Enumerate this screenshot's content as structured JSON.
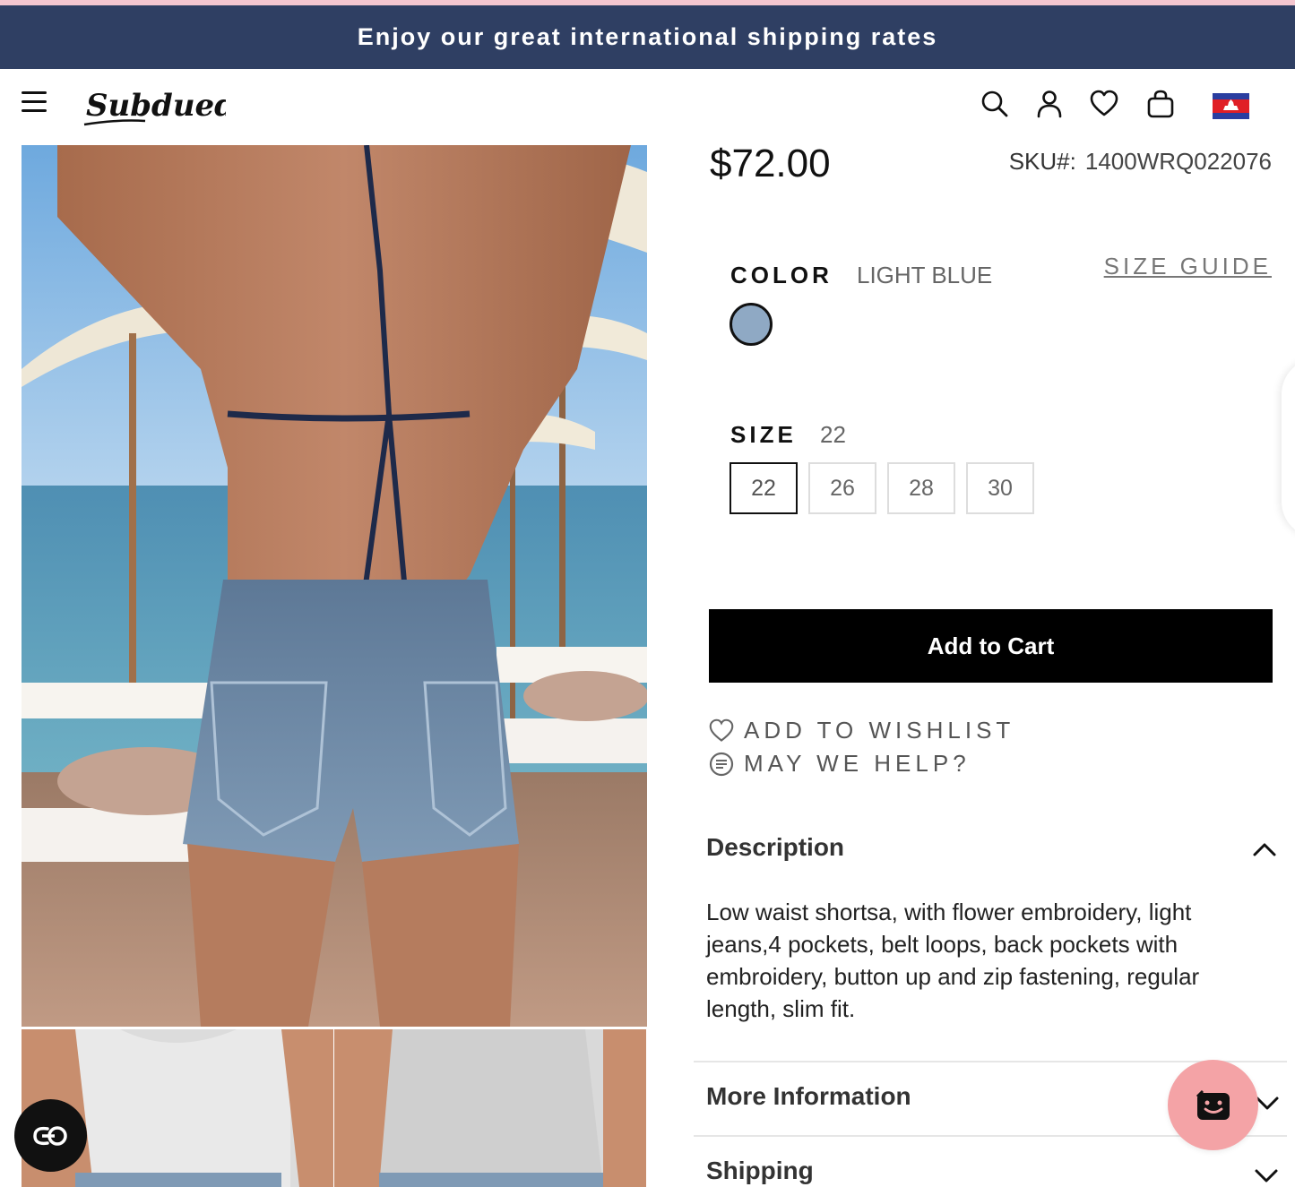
{
  "promo": {
    "text": "Enjoy our great international shipping rates"
  },
  "header": {
    "logo_text": "Subdued",
    "icons": [
      "menu-icon",
      "search-icon",
      "account-icon",
      "wishlist-heart-icon",
      "shopping-bag-icon",
      "cambodia-flag-icon"
    ]
  },
  "product": {
    "price": "$72.00",
    "sku_label": "SKU#:",
    "sku_value": "1400WRQ022076",
    "color_label": "COLOR",
    "color_value": "LIGHT BLUE",
    "size_guide": "SIZE GUIDE",
    "swatch_color": "#8fa9c4",
    "size_label": "SIZE",
    "size_value": "22",
    "sizes": [
      "22",
      "26",
      "28",
      "30"
    ],
    "selected_size": "22",
    "add_to_cart": "Add to Cart",
    "wishlist": "ADD TO WISHLIST",
    "help": "MAY WE HELP?"
  },
  "accordion": {
    "description_title": "Description",
    "description_text": "Low waist shortsa, with flower embroidery, light jeans,4 pockets, belt loops, back pockets with embroidery, button up and zip fastening, regular length, slim fit.",
    "more_info_title": "More Information",
    "shipping_title": "Shipping"
  },
  "colors": {
    "promo_bg": "#2f3f63",
    "accent_pink": "#f4a3a6",
    "button_bg": "#000000"
  }
}
